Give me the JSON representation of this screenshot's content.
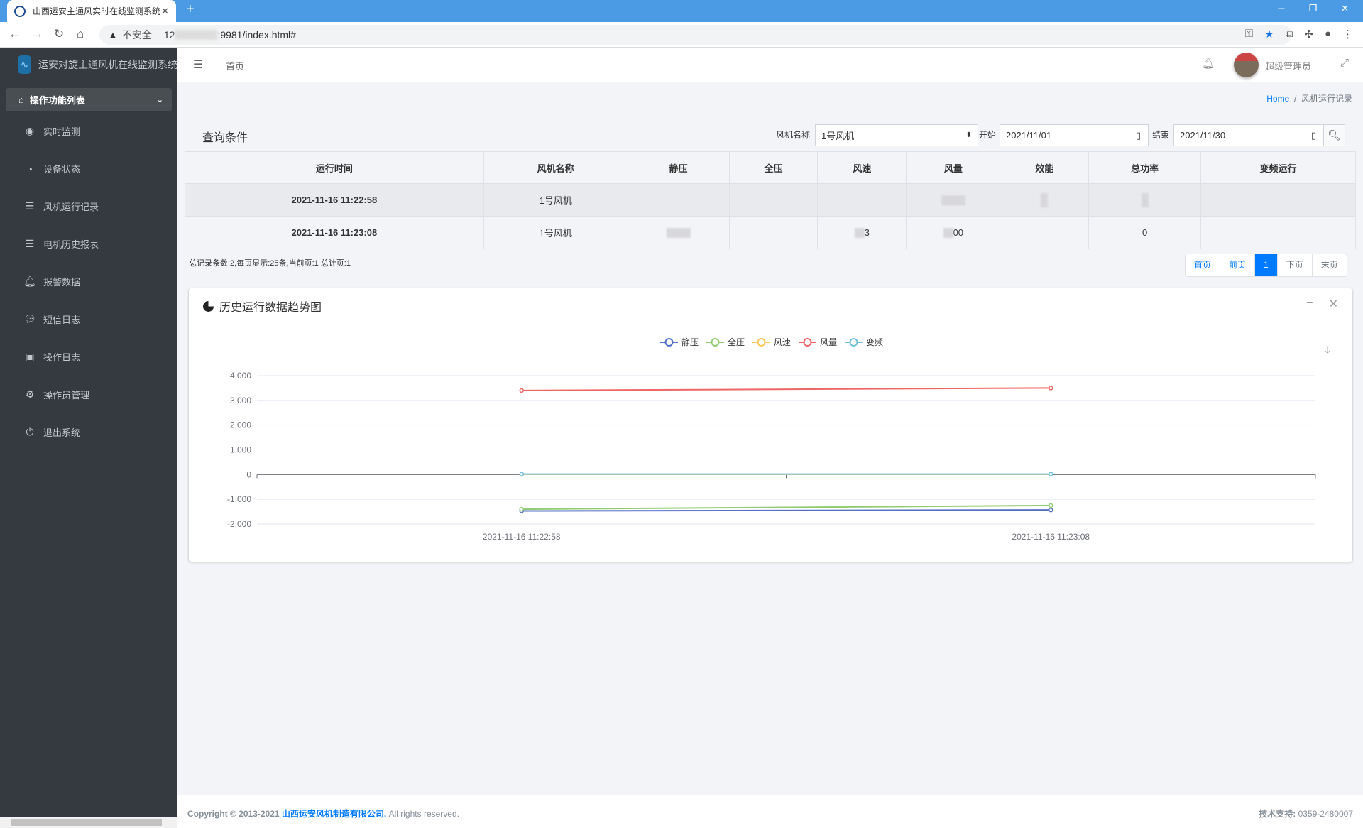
{
  "browser": {
    "tab_title": "山西运安主通风实时在线监测系统",
    "url_prefix": "12",
    "url_suffix": ":9981/index.html#",
    "insecure_label": "不安全"
  },
  "app": {
    "brand": "运安对旋主通风机在线监测系统"
  },
  "sidebar": {
    "header": "操作功能列表",
    "items": [
      {
        "label": "实时监测",
        "icon": "eye-icon"
      },
      {
        "label": "设备状态",
        "icon": "dashboard-icon"
      },
      {
        "label": "风机运行记录",
        "icon": "database-icon"
      },
      {
        "label": "电机历史报表",
        "icon": "database-icon"
      },
      {
        "label": "报警数据",
        "icon": "bell-icon"
      },
      {
        "label": "短信日志",
        "icon": "comment-icon"
      },
      {
        "label": "操作日志",
        "icon": "id-card-icon"
      },
      {
        "label": "操作员管理",
        "icon": "gear-icon"
      },
      {
        "label": "退出系统",
        "icon": "power-icon"
      }
    ]
  },
  "topbar": {
    "home": "首页",
    "user": "超级管理员"
  },
  "breadcrumb": {
    "home": "Home",
    "current": "风机运行记录"
  },
  "query": {
    "title": "查询条件",
    "fan_label": "风机名称",
    "fan_value": "1号风机",
    "start_label": "开始",
    "start_value": "2021/11/01",
    "end_label": "结束",
    "end_value": "2021/11/30"
  },
  "table": {
    "headers": [
      "运行时间",
      "风机名称",
      "静压",
      "全压",
      "风速",
      "风量",
      "效能",
      "总功率",
      "变频运行"
    ],
    "rows": [
      [
        "2021-11-16 11:22:58",
        "1号风机",
        "",
        "",
        "",
        "",
        "",
        "",
        ""
      ],
      [
        "2021-11-16 11:23:08",
        "1号风机",
        "",
        "",
        "3",
        "00",
        "",
        "0",
        ""
      ]
    ]
  },
  "summary": "总记录条数:2,每页显示:25条,当前页:1 总计页:1",
  "pager": {
    "first": "首页",
    "prev": "前页",
    "current": "1",
    "next": "下页",
    "last": "末页"
  },
  "chart_card": {
    "title": "历史运行数据趋势图"
  },
  "chart_data": {
    "type": "line",
    "x": [
      "2021-11-16 11:22:58",
      "2021-11-16 11:23:08"
    ],
    "ylim": [
      -2000,
      4000
    ],
    "yticks": [
      "4,000",
      "3,000",
      "2,000",
      "1,000",
      "0",
      "-1,000",
      "-2,000"
    ],
    "grid": true,
    "legend": "top-center",
    "series": [
      {
        "name": "静压",
        "color": "#5470c6",
        "values": [
          -1470,
          -1430
        ]
      },
      {
        "name": "全压",
        "color": "#91cc75",
        "values": [
          -1400,
          -1250
        ]
      },
      {
        "name": "风速",
        "color": "#fac858",
        "values": [
          10,
          10
        ]
      },
      {
        "name": "风量",
        "color": "#ee6666",
        "values": [
          3400,
          3500
        ]
      },
      {
        "name": "变频",
        "color": "#73c0de",
        "values": [
          20,
          20
        ]
      }
    ]
  },
  "footer": {
    "copyright": "Copyright © 2013-2021",
    "company": "山西运安风机制造有限公司.",
    "rights": "All rights reserved.",
    "support_label": "技术支持:",
    "support_phone": "0359-2480007"
  }
}
